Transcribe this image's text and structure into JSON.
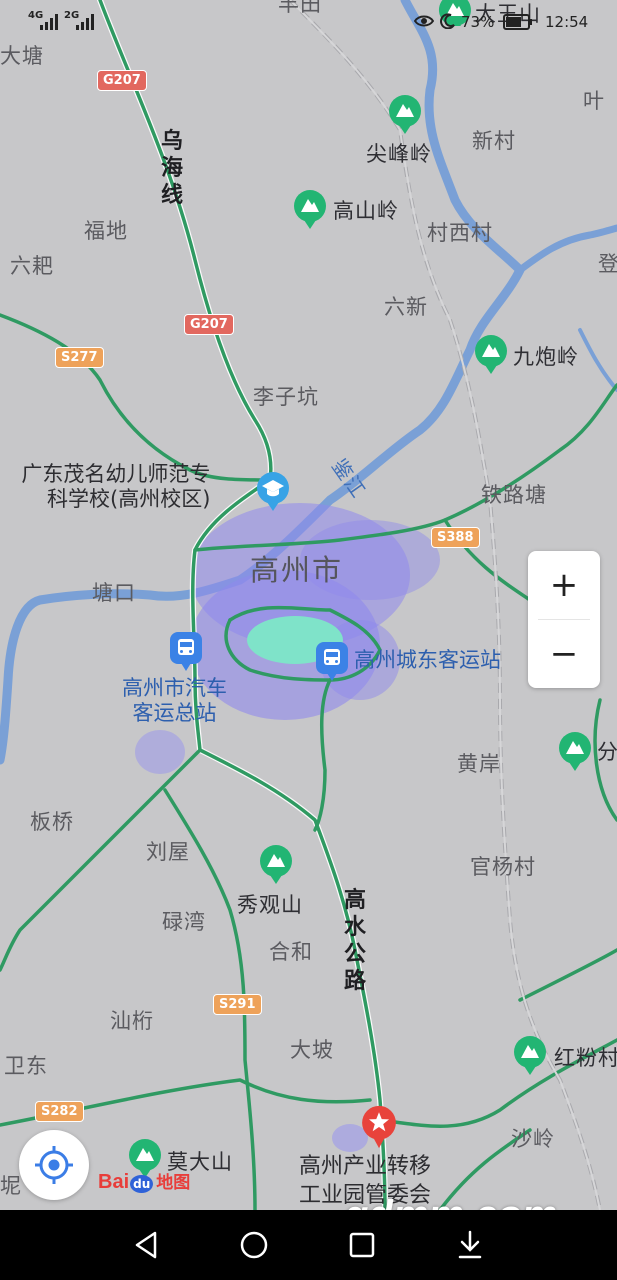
{
  "status_bar": {
    "signal_1": "4G",
    "signal_2": "2G",
    "battery": "73%",
    "time": "12:54"
  },
  "map": {
    "city_label": "高州市",
    "place_labels": [
      "大塘",
      "福地",
      "六耙",
      "李子坑",
      "塘口",
      "板桥",
      "刘屋",
      "碌湾",
      "合和",
      "汕桁",
      "卫东",
      "大坡",
      "新村",
      "村西村",
      "六新",
      "铁路塘",
      "黄岸",
      "官杨村",
      "沙岭",
      "叶",
      "登",
      "坭",
      "丰田"
    ],
    "mountains": [
      "大王山",
      "尖峰岭",
      "高山岭",
      "九炮岭",
      "秀观山",
      "红粉村",
      "分",
      "莫大山"
    ],
    "road_names": [
      "乌海线",
      "高水公路"
    ],
    "river_name": "鉴江",
    "highway_shields": [
      "G207",
      "G207",
      "S277",
      "S388",
      "S291",
      "S282"
    ],
    "school_poi": "广东茂名幼儿师范专科学校(高州校区)",
    "school_poi_line1": "广东茂名幼儿师范专",
    "school_poi_line2": "科学校(高州校区)",
    "bus_station_1_line1": "高州市汽车",
    "bus_station_1_line2": "客运总站",
    "bus_station_2": "高州城东客运站",
    "destination_line1": "高州产业转移",
    "destination_line2": "工业园管委会"
  },
  "controls": {
    "zoom_in": "+",
    "zoom_out": "−",
    "locate_icon": "locate-icon"
  },
  "logo": {
    "bai": "Bai",
    "du": "du",
    "map_text": "地图"
  },
  "watermark": "gdmm.com",
  "colors": {
    "road_green": "#2f9a62",
    "river_blue": "#7a9ed0",
    "poi_green": "#22b573",
    "heat_purple": "#8d86e8",
    "pin_red": "#e8433b"
  }
}
